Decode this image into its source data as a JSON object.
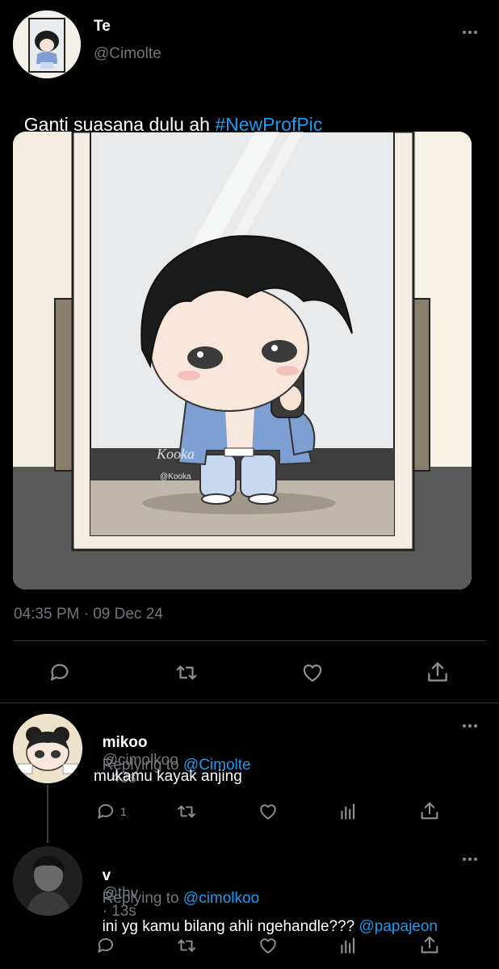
{
  "main_tweet": {
    "display_name": "Te",
    "handle": "@Cimolte",
    "text": "Ganti suasana dulu ah ",
    "hashtag": "#NewProfPic",
    "timestamp": "04:35 PM · 09 Dec 24",
    "image_watermark": "@Kooka"
  },
  "replies": [
    {
      "display_name": "mikoo",
      "handle": "@cimolkoo",
      "time": "· 43s",
      "replying_prefix": "Replying to ",
      "replying_to": "@Cimolte",
      "text": "mukamu kayak anjing",
      "mention": "",
      "reply_count": "1"
    },
    {
      "display_name": "v",
      "handle": "@thv",
      "time": "· 13s",
      "replying_prefix": "Replying to ",
      "replying_to": "@cimolkoo",
      "text": "ini yg kamu bilang ahli ngehandle??? ",
      "mention": "@papajeon",
      "reply_count": ""
    }
  ],
  "icons": [
    "more-icon",
    "reply-icon",
    "retweet-icon",
    "like-icon",
    "share-icon",
    "analytics-icon"
  ],
  "colors": {
    "background": "#000000",
    "link": "#1d9bf0",
    "muted": "#71767b",
    "divider": "#2f3336"
  }
}
